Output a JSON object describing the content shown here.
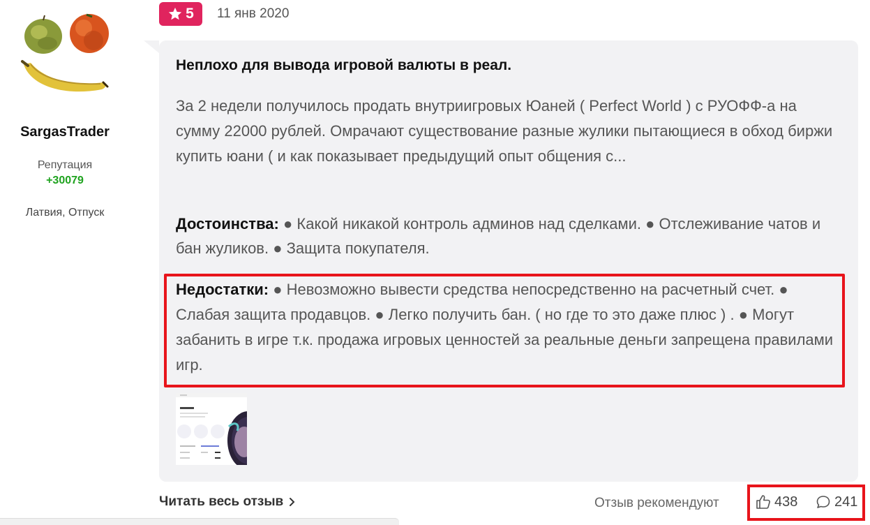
{
  "author": {
    "avatar_icon": "fruit-face-avatar",
    "username": "SargasTrader",
    "reputation_label": "Репутация",
    "reputation_value": "+30079",
    "location": "Латвия, Отпуск"
  },
  "review": {
    "rating": "5",
    "rating_icon": "star-icon",
    "date": "11 янв 2020",
    "title": "Неплохо для вывода игровой валюты в реал.",
    "text": "За 2 недели получилось продать внутриигровых Юаней ( Perfect World ) с РУОФФ-а на сумму 22000 рублей. Омрачают существование разные жулики пытающиеся в обход биржи купить юани ( и как показывает предыдущий опыт общения с...",
    "pros_label": "Достоинства:",
    "pros_text": " ● Какой никакой контроль админов над сделками. ● Отслеживание чатов и бан жуликов. ● Защита покупателя.",
    "cons_label": "Недостатки:",
    "cons_text": " ● Невозможно вывести средства непосредственно на расчетный счет. ● Слабая защита продавцов. ● Легко получить бан. ( но где то это даже плюс ) . ● Могут забанить в игре т.к. продажа игровых ценностей за реальные деньги запрещена правилами игр.",
    "attachment_icon": "screenshot-thumbnail"
  },
  "footer": {
    "read_more": "Читать весь отзыв",
    "recommend_label": "Отзыв рекомендуют",
    "likes": "438",
    "comments": "241"
  },
  "colors": {
    "accent": "#e0245e",
    "highlight": "#e8141b",
    "reputation": "#1fa31f",
    "card_bg": "#f2f2f4"
  }
}
